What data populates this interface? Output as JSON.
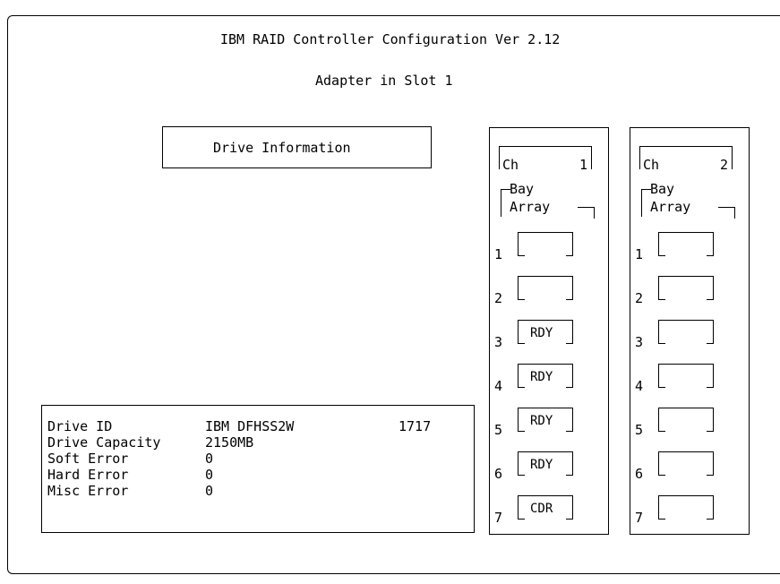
{
  "header": {
    "title": "IBM RAID Controller Configuration Ver 2.12",
    "subtitle": "Adapter in Slot 1"
  },
  "drive_info_button": "Drive Information",
  "details": [
    {
      "label": "Drive ID",
      "value": "IBM DFHSS2W",
      "extra": "1717"
    },
    {
      "label": "Drive Capacity",
      "value": "2150MB",
      "extra": ""
    },
    {
      "label": "Soft Error",
      "value": "0",
      "extra": ""
    },
    {
      "label": "Hard Error",
      "value": "0",
      "extra": ""
    },
    {
      "label": "Misc Error",
      "value": "0",
      "extra": ""
    }
  ],
  "channels": [
    {
      "ch_label": "Ch",
      "ch_num": "1",
      "bay_label": "Bay",
      "array_label": "Array",
      "bays": [
        {
          "num": "1",
          "status": ""
        },
        {
          "num": "2",
          "status": ""
        },
        {
          "num": "3",
          "status": "RDY"
        },
        {
          "num": "4",
          "status": "RDY"
        },
        {
          "num": "5",
          "status": "RDY"
        },
        {
          "num": "6",
          "status": "RDY"
        },
        {
          "num": "7",
          "status": "CDR"
        }
      ]
    },
    {
      "ch_label": "Ch",
      "ch_num": "2",
      "bay_label": "Bay",
      "array_label": "Array",
      "bays": [
        {
          "num": "1",
          "status": ""
        },
        {
          "num": "2",
          "status": ""
        },
        {
          "num": "3",
          "status": ""
        },
        {
          "num": "4",
          "status": ""
        },
        {
          "num": "5",
          "status": ""
        },
        {
          "num": "6",
          "status": ""
        },
        {
          "num": "7",
          "status": ""
        }
      ]
    }
  ]
}
